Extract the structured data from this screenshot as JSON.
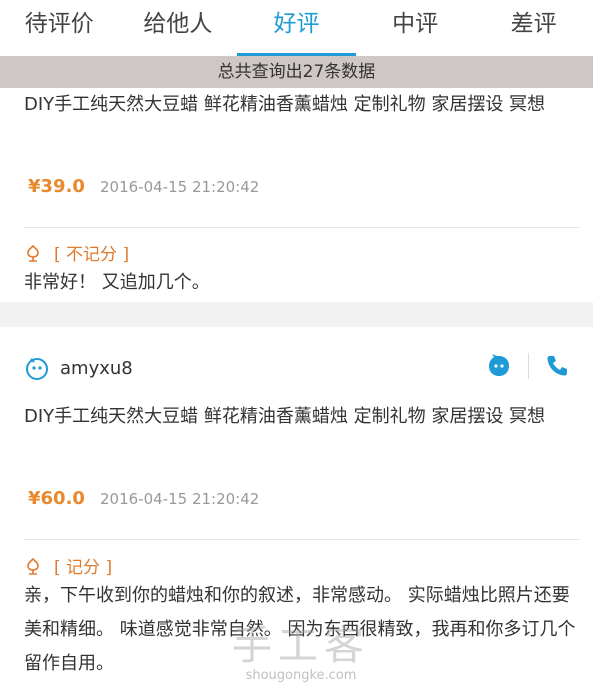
{
  "tabs": [
    {
      "label": "待评价",
      "active": false
    },
    {
      "label": "给他人",
      "active": false
    },
    {
      "label": "好评",
      "active": true
    },
    {
      "label": "中评",
      "active": false
    },
    {
      "label": "差评",
      "active": false
    }
  ],
  "result_count": "总共查询出27条数据",
  "reviews": [
    {
      "product_title": "DIY手工纯天然大豆蜡 鲜花精油香薰蜡烛 定制礼物 家居摆设 冥想",
      "price": "¥39.0",
      "date": "2016-04-15 21:20:42",
      "score_tag": "[ 不记分 ]",
      "review_text": "非常好！ 又追加几个。"
    },
    {
      "username": "amyxu8",
      "product_title": "DIY手工纯天然大豆蜡 鲜花精油香薰蜡烛 定制礼物 家居摆设 冥想",
      "price": "¥60.0",
      "date": "2016-04-15 21:20:42",
      "score_tag": "[ 记分 ]",
      "review_text": "亲，下午收到你的蜡烛和你的叙述，非常感动。 实际蜡烛比照片还要美和精细。 味道感觉非常自然。 因为东西很精致，我再和你多订几个留作自用。"
    }
  ],
  "icons": {
    "user": "wangwang-avatar-icon",
    "chat": "chat-bubble-icon",
    "phone": "phone-icon",
    "tag": "flower-icon"
  },
  "colors": {
    "accent": "#1e9ad6",
    "price": "#e8892b",
    "tag": "#e07a2e"
  },
  "watermark": {
    "cn": "手工客",
    "url": "shougongke.com"
  }
}
